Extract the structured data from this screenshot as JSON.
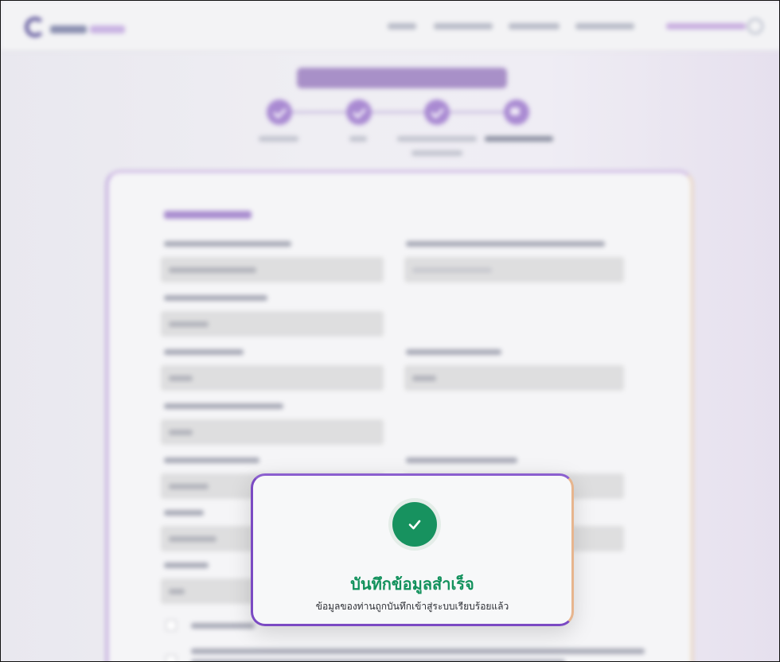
{
  "modal": {
    "title": "บันทึกข้อมูลสำเร็จ",
    "message": "ข้อมูลของท่านถูกบันทึกเข้าสู่ระบบเรียบร้อยแล้ว",
    "icon": "check-circle-icon",
    "accent_color": "#17925f"
  },
  "background": {
    "blurred": true,
    "stepper": {
      "completed_steps": 3,
      "total_steps": 4
    }
  },
  "colors": {
    "brand_purple": "#7b4ac3",
    "success_green": "#12915c"
  }
}
